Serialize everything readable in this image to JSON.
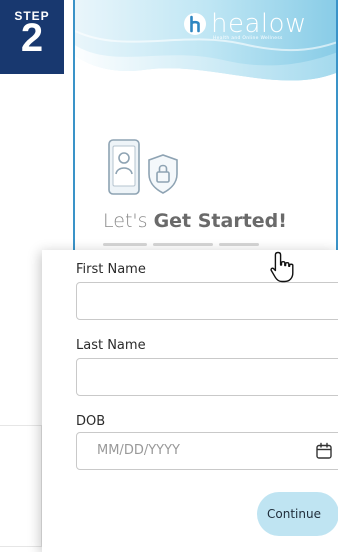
{
  "step": {
    "word": "STEP",
    "number": "2"
  },
  "brand": {
    "name": "healow",
    "tagline": "Health and Online Wellness"
  },
  "hero": {
    "title_prefix": "Let's ",
    "title_bold": "Get Started!"
  },
  "form": {
    "first_name_label": "First Name",
    "first_name_value": "",
    "last_name_label": "Last Name",
    "last_name_value": "",
    "dob_label": "DOB",
    "dob_placeholder": "MM/DD/YYYY",
    "continue_label": "Continue"
  },
  "colors": {
    "step_badge": "#18386f",
    "panel_border": "#3a93c8",
    "header_light": "#d9f0f8",
    "header_mid": "#8dd0ea",
    "button_bg": "#bfe4f2"
  }
}
